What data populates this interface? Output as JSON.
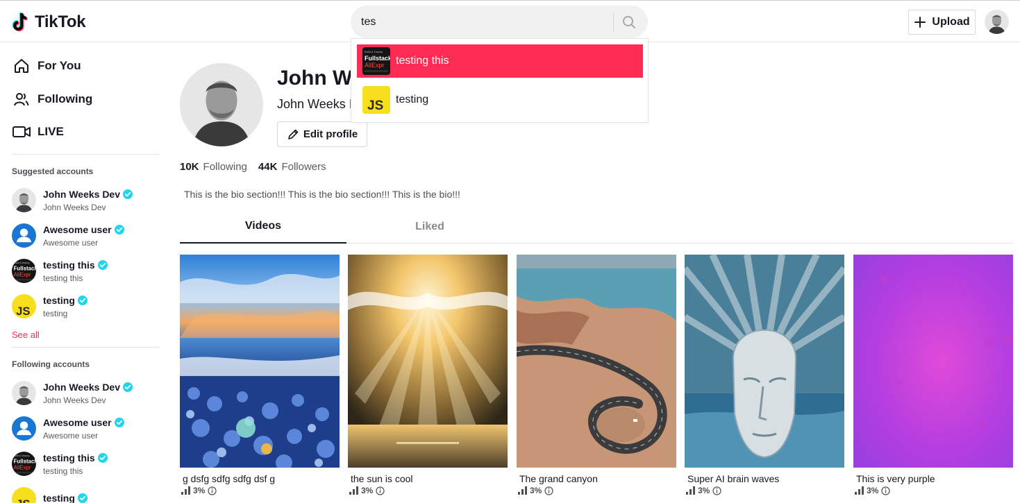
{
  "app": {
    "name": "TikTok"
  },
  "header": {
    "search_value": "tes",
    "upload_label": "Upload"
  },
  "search_results": [
    {
      "label": "testing this",
      "active": true
    },
    {
      "label": "testing",
      "active": false
    }
  ],
  "sidebar": {
    "nav": [
      {
        "label": "For You",
        "icon": "home-icon"
      },
      {
        "label": "Following",
        "icon": "people-icon"
      },
      {
        "label": "LIVE",
        "icon": "live-icon"
      }
    ],
    "suggested_title": "Suggested accounts",
    "suggested": [
      {
        "name": "John Weeks Dev",
        "handle": "John Weeks Dev"
      },
      {
        "name": "Awesome user",
        "handle": "Awesome user"
      },
      {
        "name": "testing this",
        "handle": "testing this"
      },
      {
        "name": "testing",
        "handle": "testing"
      }
    ],
    "see_all": "See all",
    "following_title": "Following accounts",
    "following": [
      {
        "name": "John Weeks Dev",
        "handle": "John Weeks Dev"
      },
      {
        "name": "Awesome user",
        "handle": "Awesome user"
      },
      {
        "name": "testing this",
        "handle": "testing this"
      },
      {
        "name": "testing",
        "handle": ""
      }
    ]
  },
  "profile": {
    "name": "John W",
    "subname": "John Weeks I",
    "edit_label": "Edit profile",
    "following_count": "10K",
    "following_label": "Following",
    "followers_count": "44K",
    "followers_label": "Followers",
    "bio": "This is the bio section!!! This is the bio section!!! This is the bio!!!"
  },
  "tabs": [
    {
      "label": "Videos",
      "active": true
    },
    {
      "label": "Liked",
      "active": false
    }
  ],
  "videos": [
    {
      "caption": "g dsfg sdfg sdfg dsf g",
      "stat": "3%"
    },
    {
      "caption": "the sun is cool",
      "stat": "3%"
    },
    {
      "caption": "The grand canyon",
      "stat": "3%"
    },
    {
      "caption": "Super AI brain waves",
      "stat": "3%"
    },
    {
      "caption": "This is very purple",
      "stat": "3%"
    }
  ],
  "colors": {
    "accent": "#fe2c55",
    "verified": "#20d5ec",
    "text": "#161823"
  }
}
